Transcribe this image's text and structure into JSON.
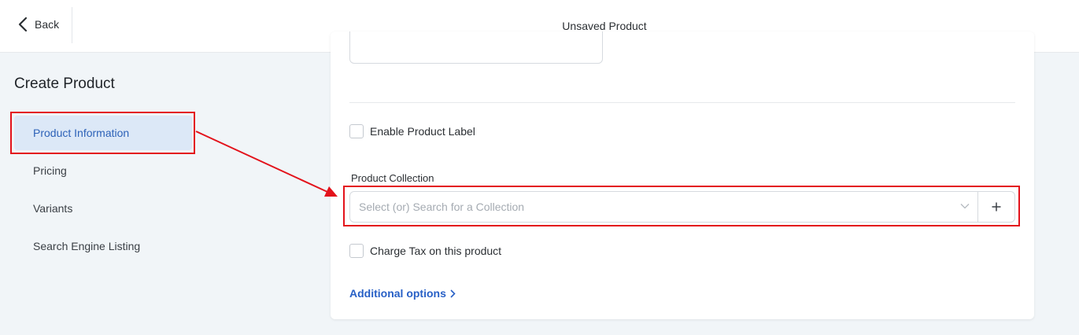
{
  "header": {
    "back_label": "Back",
    "title": "Unsaved Product"
  },
  "sidebar": {
    "title": "Create Product",
    "items": [
      {
        "label": "Product Information",
        "active": true
      },
      {
        "label": "Pricing",
        "active": false
      },
      {
        "label": "Variants",
        "active": false
      },
      {
        "label": "Search Engine Listing",
        "active": false
      }
    ]
  },
  "form": {
    "enable_label": "Enable Product Label",
    "collection_label": "Product Collection",
    "collection_placeholder": "Select (or) Search for a Collection",
    "charge_tax_label": "Charge Tax on this product",
    "additional_options": "Additional options"
  },
  "colors": {
    "accent": "#2860c6",
    "highlight_bg": "#dce8f7",
    "annotation": "#e3121b",
    "page_bg": "#f1f5f8"
  }
}
